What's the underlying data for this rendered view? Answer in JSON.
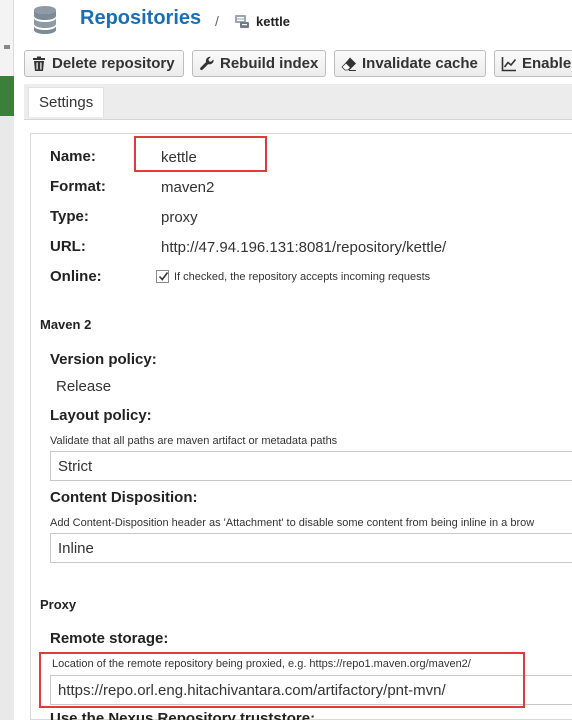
{
  "header": {
    "title": "Repositories",
    "separator": "/",
    "repo_name": "kettle"
  },
  "toolbar": {
    "delete_label": "Delete repository",
    "rebuild_label": "Rebuild index",
    "invalidate_label": "Invalidate cache",
    "enable_label": "Enable"
  },
  "tabs": {
    "settings": "Settings"
  },
  "settings": {
    "name_label": "Name:",
    "name_value": "kettle",
    "format_label": "Format:",
    "format_value": "maven2",
    "type_label": "Type:",
    "type_value": "proxy",
    "url_label": "URL:",
    "url_value": "http://47.94.196.131:8081/repository/kettle/",
    "online_label": "Online:",
    "online_checked": true,
    "online_help": "If checked, the repository accepts incoming requests"
  },
  "maven": {
    "section": "Maven 2",
    "version_label": "Version policy:",
    "version_value": "Release",
    "layout_label": "Layout policy:",
    "layout_help": "Validate that all paths are maven artifact or metadata paths",
    "layout_value": "Strict",
    "disposition_label": "Content Disposition:",
    "disposition_help": "Add Content-Disposition header as 'Attachment' to disable some content from being inline in a brow",
    "disposition_value": "Inline"
  },
  "proxy": {
    "section": "Proxy",
    "remote_label": "Remote storage:",
    "remote_help": "Location of the remote repository being proxied, e.g. https://repo1.maven.org/maven2/",
    "remote_value": "https://repo.orl.eng.hitachivantara.com/artifactory/pnt-mvn/",
    "truststore_label": "Use the Nexus Repository truststore:"
  },
  "colors": {
    "accent": "#1a6fb4",
    "highlight": "#e03a3a",
    "sidebar_active": "#3b7f3b"
  }
}
